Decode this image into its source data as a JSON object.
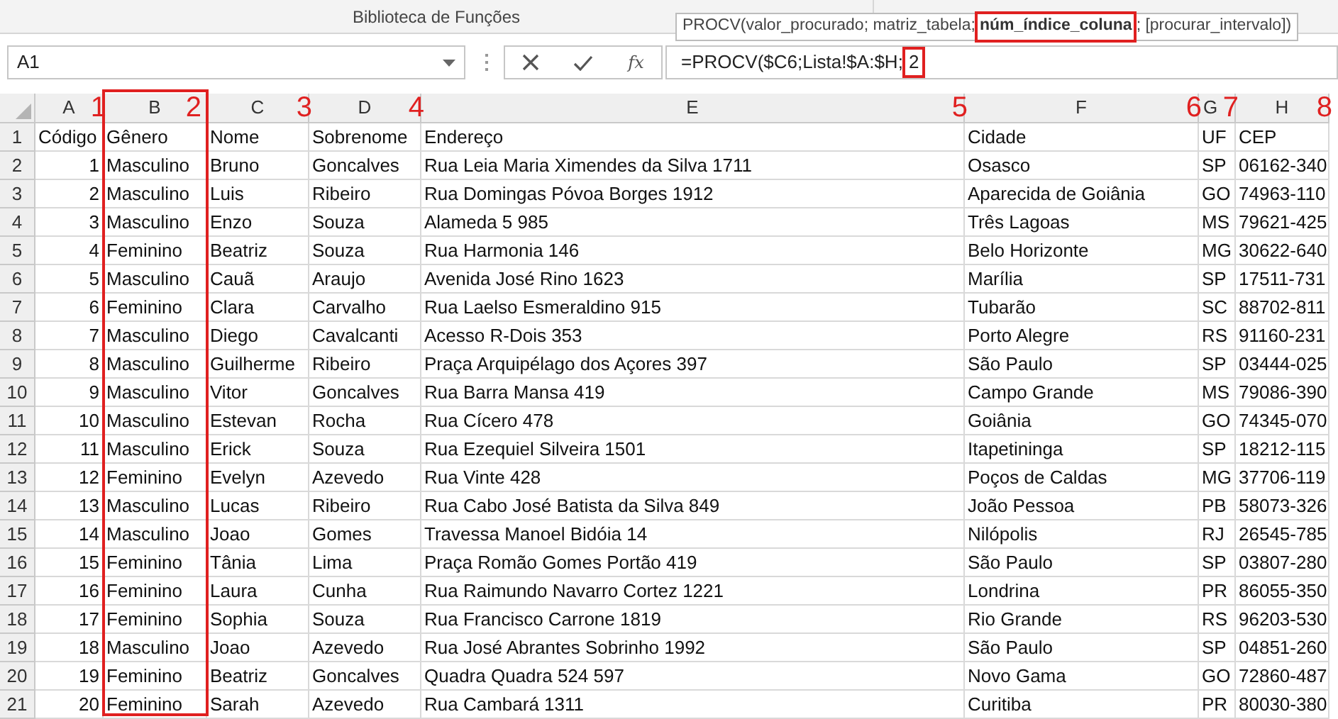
{
  "ribbon": {
    "group_label": "Biblioteca de Funções"
  },
  "tooltip": {
    "parts": [
      {
        "text": "PROCV(valor_procurado; matriz_tabela; ",
        "current": false
      },
      {
        "text": "núm_índice_coluna",
        "current": true
      },
      {
        "text": "; [procurar_intervalo])",
        "current": false
      }
    ]
  },
  "name_box": {
    "value": "A1"
  },
  "function_button": "fx",
  "formula": {
    "text": "=PROCV($C6;Lista!$A:$H;",
    "marked": "2"
  },
  "columns": [
    {
      "letter": "A",
      "annotation": "1",
      "highlighted": false
    },
    {
      "letter": "B",
      "annotation": "2",
      "highlighted": true
    },
    {
      "letter": "C",
      "annotation": "3",
      "highlighted": false
    },
    {
      "letter": "D",
      "annotation": "4",
      "highlighted": false
    },
    {
      "letter": "E",
      "annotation": "5",
      "highlighted": false
    },
    {
      "letter": "F",
      "annotation": "6",
      "highlighted": false
    },
    {
      "letter": "G",
      "annotation": "7",
      "highlighted": false
    },
    {
      "letter": "H",
      "annotation": "8",
      "highlighted": false
    }
  ],
  "rows": [
    {
      "number": "1",
      "kind": "header",
      "cells": [
        "Código",
        "Gênero",
        "Nome",
        "Sobrenome",
        "Endereço",
        "Cidade",
        "UF",
        "CEP"
      ]
    },
    {
      "number": "2",
      "kind": "record",
      "cells": [
        "1",
        "Masculino",
        "Bruno",
        "Goncalves",
        "Rua Leia Maria Ximendes da Silva 1711",
        "Osasco",
        "SP",
        "06162-340"
      ]
    },
    {
      "number": "3",
      "kind": "record",
      "cells": [
        "2",
        "Masculino",
        "Luis",
        "Ribeiro",
        "Rua Domingas Póvoa Borges 1912",
        "Aparecida de Goiânia",
        "GO",
        "74963-110"
      ]
    },
    {
      "number": "4",
      "kind": "record",
      "cells": [
        "3",
        "Masculino",
        "Enzo",
        "Souza",
        "Alameda 5 985",
        "Três Lagoas",
        "MS",
        "79621-425"
      ]
    },
    {
      "number": "5",
      "kind": "record",
      "cells": [
        "4",
        "Feminino",
        "Beatriz",
        "Souza",
        "Rua Harmonia 146",
        "Belo Horizonte",
        "MG",
        "30622-640"
      ]
    },
    {
      "number": "6",
      "kind": "record",
      "cells": [
        "5",
        "Masculino",
        "Cauã",
        "Araujo",
        "Avenida José Rino 1623",
        "Marília",
        "SP",
        "17511-731"
      ]
    },
    {
      "number": "7",
      "kind": "record",
      "cells": [
        "6",
        "Feminino",
        "Clara",
        "Carvalho",
        "Rua Laelso Esmeraldino 915",
        "Tubarão",
        "SC",
        "88702-811"
      ]
    },
    {
      "number": "8",
      "kind": "record",
      "cells": [
        "7",
        "Masculino",
        "Diego",
        "Cavalcanti",
        "Acesso R-Dois 353",
        "Porto Alegre",
        "RS",
        "91160-231"
      ]
    },
    {
      "number": "9",
      "kind": "record",
      "cells": [
        "8",
        "Masculino",
        "Guilherme",
        "Ribeiro",
        "Praça Arquipélago dos Açores 397",
        "São Paulo",
        "SP",
        "03444-025"
      ]
    },
    {
      "number": "10",
      "kind": "record",
      "cells": [
        "9",
        "Masculino",
        "Vitor",
        "Goncalves",
        "Rua Barra Mansa 419",
        "Campo Grande",
        "MS",
        "79086-390"
      ]
    },
    {
      "number": "11",
      "kind": "record",
      "cells": [
        "10",
        "Masculino",
        "Estevan",
        "Rocha",
        "Rua Cícero 478",
        "Goiânia",
        "GO",
        "74345-070"
      ]
    },
    {
      "number": "12",
      "kind": "record",
      "cells": [
        "11",
        "Masculino",
        "Erick",
        "Souza",
        "Rua Ezequiel Silveira 1501",
        "Itapetininga",
        "SP",
        "18212-115"
      ]
    },
    {
      "number": "13",
      "kind": "record",
      "cells": [
        "12",
        "Feminino",
        "Evelyn",
        "Azevedo",
        "Rua Vinte 428",
        "Poços de Caldas",
        "MG",
        "37706-119"
      ]
    },
    {
      "number": "14",
      "kind": "record",
      "cells": [
        "13",
        "Masculino",
        "Lucas",
        "Ribeiro",
        "Rua Cabo José Batista da Silva 849",
        "João Pessoa",
        "PB",
        "58073-326"
      ]
    },
    {
      "number": "15",
      "kind": "record",
      "cells": [
        "14",
        "Masculino",
        "Joao",
        "Gomes",
        "Travessa Manoel Bidóia 14",
        "Nilópolis",
        "RJ",
        "26545-785"
      ]
    },
    {
      "number": "16",
      "kind": "record",
      "cells": [
        "15",
        "Feminino",
        "Tânia",
        "Lima",
        "Praça Romão Gomes Portão 419",
        "São Paulo",
        "SP",
        "03807-280"
      ]
    },
    {
      "number": "17",
      "kind": "record",
      "cells": [
        "16",
        "Feminino",
        "Laura",
        "Cunha",
        "Rua Raimundo Navarro Cortez 1221",
        "Londrina",
        "PR",
        "86055-350"
      ]
    },
    {
      "number": "18",
      "kind": "record",
      "cells": [
        "17",
        "Feminino",
        "Sophia",
        "Souza",
        "Rua Francisco Carrone 1819",
        "Rio Grande",
        "RS",
        "96203-530"
      ]
    },
    {
      "number": "19",
      "kind": "record",
      "cells": [
        "18",
        "Masculino",
        "Joao",
        "Azevedo",
        "Rua José Abrantes Sobrinho 1992",
        "São Paulo",
        "SP",
        "04851-260"
      ]
    },
    {
      "number": "20",
      "kind": "record",
      "cells": [
        "19",
        "Feminino",
        "Beatriz",
        "Goncalves",
        "Quadra Quadra 524 597",
        "Novo Gama",
        "GO",
        "72860-487"
      ]
    },
    {
      "number": "21",
      "kind": "record",
      "cells": [
        "20",
        "Feminino",
        "Sarah",
        "Azevedo",
        "Rua Cambará 1311",
        "Curitiba",
        "PR",
        "80030-380"
      ]
    }
  ]
}
